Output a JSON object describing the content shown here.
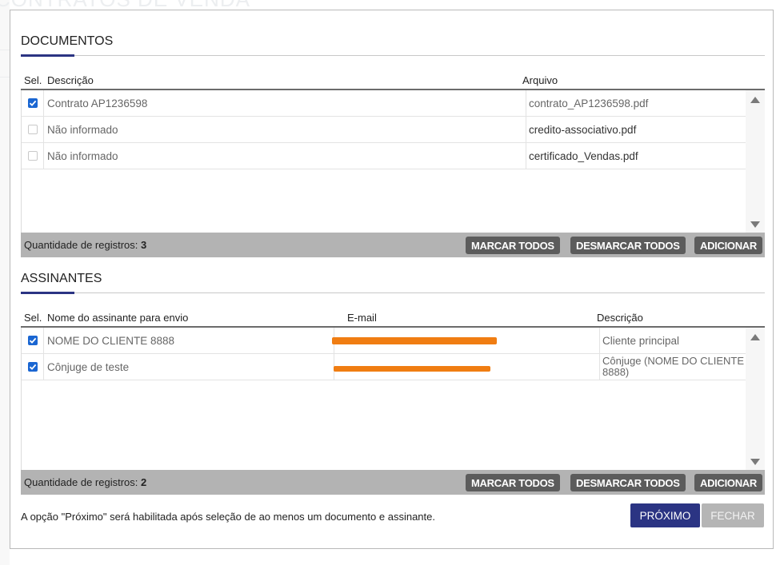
{
  "background": {
    "title": "CONTRATOS DE VENDA"
  },
  "documents": {
    "title": "DOCUMENTOS",
    "headers": {
      "sel": "Sel.",
      "description": "Descrição",
      "file": "Arquivo"
    },
    "rows": [
      {
        "checked": true,
        "description": "Contrato AP1236598",
        "file": "contrato_AP1236598.pdf"
      },
      {
        "checked": false,
        "description": "Não informado",
        "file": "credito-associativo.pdf"
      },
      {
        "checked": false,
        "description": "Não informado",
        "file": "certificado_Vendas.pdf"
      }
    ],
    "count_label": "Quantidade de registros:",
    "count": "3",
    "buttons": {
      "mark_all": "MARCAR TODOS",
      "unmark_all": "DESMARCAR TODOS",
      "add": "ADICIONAR"
    }
  },
  "signers": {
    "title": "ASSINANTES",
    "headers": {
      "sel": "Sel.",
      "name": "Nome do assinante para envio",
      "email": "E-mail",
      "description": "Descrição"
    },
    "rows": [
      {
        "checked": true,
        "name": "NOME DO CLIENTE 8888",
        "email": "",
        "description": "Cliente principal"
      },
      {
        "checked": true,
        "name": "Cônjuge de teste",
        "email": "",
        "description": "Cônjuge (NOME DO CLIENTE 8888)"
      }
    ],
    "count_label": "Quantidade de registros:",
    "count": "2",
    "buttons": {
      "mark_all": "MARCAR TODOS",
      "unmark_all": "DESMARCAR TODOS",
      "add": "ADICIONAR"
    }
  },
  "footer": {
    "note": "A opção \"Próximo\" será habilitada após seleção de ao menos um documento e assinante.",
    "next_label": "PRÓXIMO",
    "close_label": "FECHAR"
  },
  "colors": {
    "accent": "#2b3483",
    "checkbox": "#1a66d2",
    "button_dark": "#5c5c5c",
    "footer_bar": "#b3b3b3",
    "redaction": "#f07d12"
  },
  "icons": {
    "checkbox_checked": "check-icon",
    "scroll_up": "triangle-up-icon",
    "scroll_down": "triangle-down-icon"
  }
}
